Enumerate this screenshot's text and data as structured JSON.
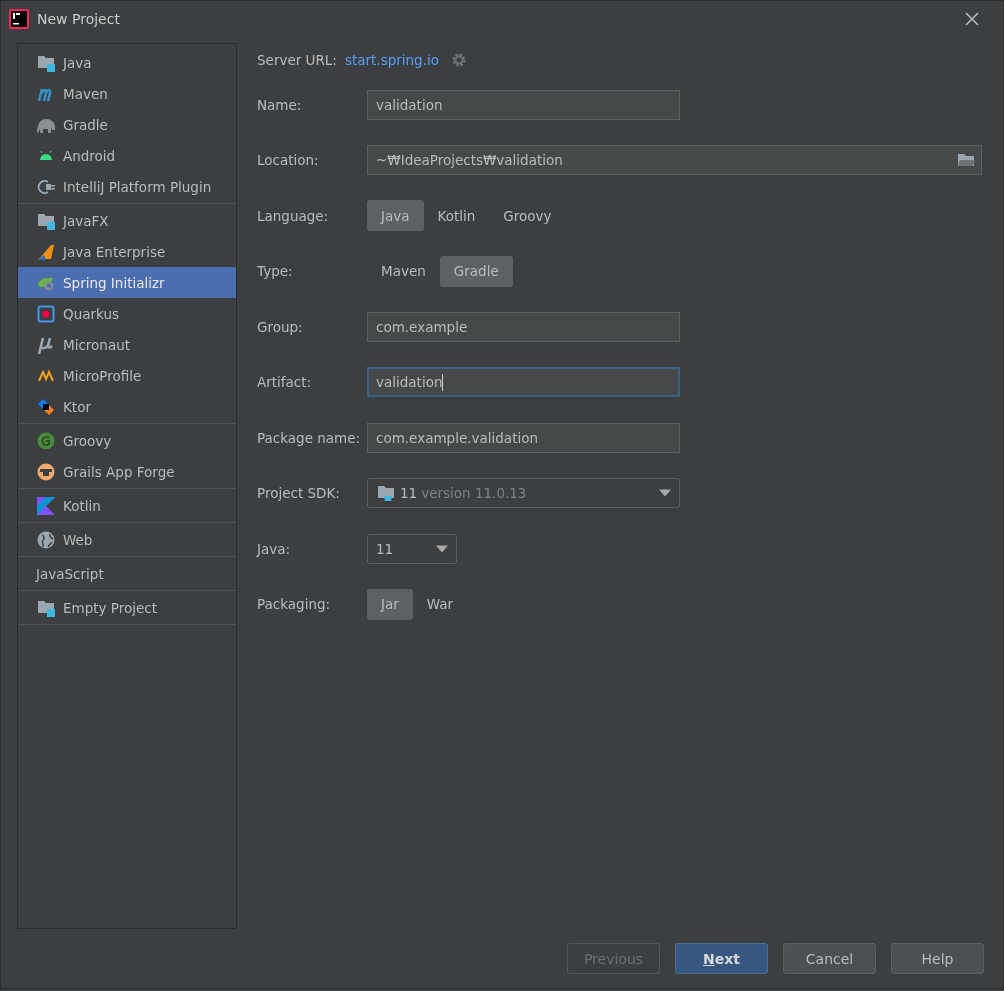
{
  "window": {
    "title": "New Project"
  },
  "sidebar": {
    "groups": [
      {
        "items": [
          {
            "label": "Java",
            "selected": false
          },
          {
            "label": "Maven",
            "selected": false
          },
          {
            "label": "Gradle",
            "selected": false
          },
          {
            "label": "Android",
            "selected": false
          },
          {
            "label": "IntelliJ Platform Plugin",
            "selected": false
          }
        ]
      },
      {
        "items": [
          {
            "label": "JavaFX",
            "selected": false
          },
          {
            "label": "Java Enterprise",
            "selected": false
          },
          {
            "label": "Spring Initializr",
            "selected": true
          },
          {
            "label": "Quarkus",
            "selected": false
          },
          {
            "label": "Micronaut",
            "selected": false
          },
          {
            "label": "MicroProfile",
            "selected": false
          },
          {
            "label": "Ktor",
            "selected": false
          }
        ]
      },
      {
        "items": [
          {
            "label": "Groovy",
            "selected": false
          },
          {
            "label": "Grails App Forge",
            "selected": false
          }
        ]
      },
      {
        "items": [
          {
            "label": "Kotlin",
            "selected": false
          }
        ]
      },
      {
        "items": [
          {
            "label": "Web",
            "selected": false
          }
        ]
      },
      {
        "items": [
          {
            "label": "JavaScript",
            "selected": false
          }
        ]
      },
      {
        "items": [
          {
            "label": "Empty Project",
            "selected": false
          }
        ]
      }
    ]
  },
  "server": {
    "label": "Server URL:",
    "link": "start.spring.io"
  },
  "form": [
    {
      "kind": "text",
      "label": "Name:",
      "value": "validation",
      "focused": false
    },
    {
      "kind": "path",
      "label": "Location:",
      "value": "~₩IdeaProjects₩validation"
    },
    {
      "kind": "choice",
      "label": "Language:",
      "options": [
        {
          "label": "Java",
          "selected": true
        },
        {
          "label": "Kotlin",
          "selected": false
        },
        {
          "label": "Groovy",
          "selected": false
        }
      ]
    },
    {
      "kind": "choice",
      "label": "Type:",
      "options": [
        {
          "label": "Maven",
          "selected": false
        },
        {
          "label": "Gradle",
          "selected": true
        }
      ]
    },
    {
      "kind": "text",
      "label": "Group:",
      "value": "com.example",
      "focused": false
    },
    {
      "kind": "text",
      "label": "Artifact:",
      "value": "validation",
      "focused": true
    },
    {
      "kind": "text",
      "label": "Package name:",
      "value": "com.example.validation",
      "focused": false
    },
    {
      "kind": "sdk",
      "label": "Project SDK:",
      "value": "11",
      "detail": "version 11.0.13"
    },
    {
      "kind": "combo",
      "label": "Java:",
      "value": "11"
    },
    {
      "kind": "choice",
      "label": "Packaging:",
      "options": [
        {
          "label": "Jar",
          "selected": true
        },
        {
          "label": "War",
          "selected": false
        }
      ]
    }
  ],
  "buttons": [
    {
      "label": "Previous",
      "disabled": true,
      "default": false
    },
    {
      "label": "Next",
      "disabled": false,
      "default": true
    },
    {
      "label": "Cancel",
      "disabled": false,
      "default": false
    },
    {
      "label": "Help",
      "disabled": false,
      "default": false
    }
  ]
}
